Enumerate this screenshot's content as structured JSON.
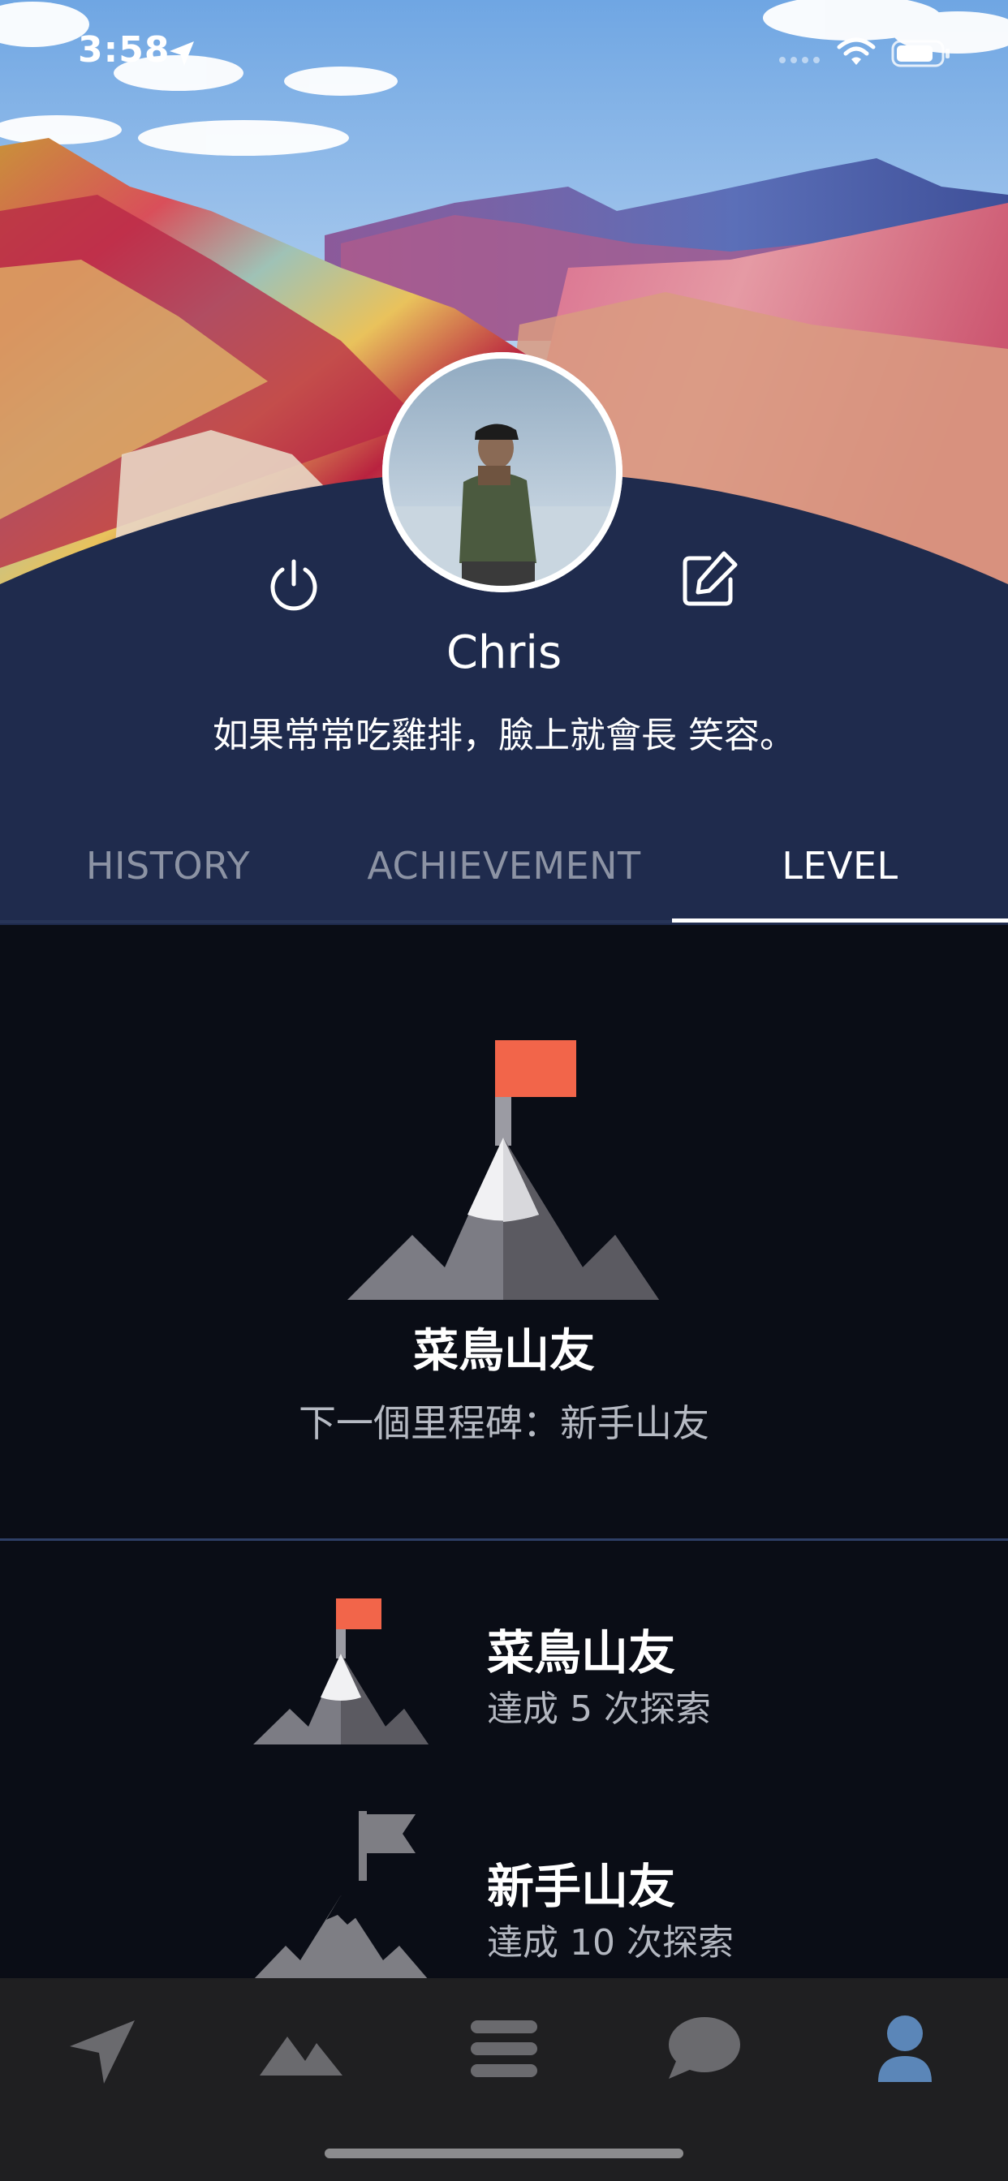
{
  "status_bar": {
    "time": "3:58"
  },
  "profile": {
    "name": "Chris",
    "bio": "如果常常吃雞排，臉上就會長 笑容。"
  },
  "tabs": [
    {
      "label": "HISTORY",
      "active": false
    },
    {
      "label": "ACHIEVEMENT",
      "active": false
    },
    {
      "label": "LEVEL",
      "active": true
    }
  ],
  "current_level": {
    "name": "菜鳥山友",
    "next_milestone": "下一個里程碑：新手山友"
  },
  "levels": [
    {
      "name": "菜鳥山友",
      "requirement": "達成 5 次探索",
      "icon": "mountain-flag-colored-icon"
    },
    {
      "name": "新手山友",
      "requirement": "達成 10 次探索",
      "icon": "mountain-flag-gray-icon"
    }
  ],
  "bottom_nav": [
    {
      "icon": "navigation-arrow-icon",
      "active": false
    },
    {
      "icon": "mountains-icon",
      "active": false
    },
    {
      "icon": "menu-list-icon",
      "active": false
    },
    {
      "icon": "chat-bubble-icon",
      "active": false
    },
    {
      "icon": "user-profile-icon",
      "active": true
    }
  ],
  "colors": {
    "panel": "#1f2b4d",
    "content_bg": "#0a0d16",
    "flag": "#f2654a",
    "active_nav": "#5b86b8",
    "inactive_nav": "#6a6a6e"
  }
}
